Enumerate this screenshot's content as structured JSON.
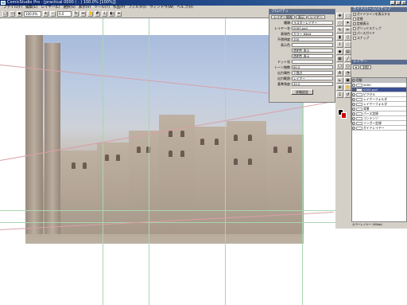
{
  "window": {
    "title": "ComicStudio Pro - [practical 0000 (  :  ) 100.0% [100%]]"
  },
  "menu": [
    "ファイル(F)",
    "編集(E)",
    "レイヤー(L)",
    "選択(S)",
    "表示(V)",
    "ツール(T)",
    "作品(P)",
    "フィルタ(I)",
    "ウィンドウ(W)",
    "ヘルプ(H)"
  ],
  "toolbar": {
    "zoom": "100.0%",
    "angle": "0.0"
  },
  "properties": {
    "title": "プロパティ",
    "tabs": [
      "レイヤー情報",
      "表示",
      "レイヤー"
    ],
    "rows": [
      {
        "label": "種類",
        "value": "ラスターレイヤー"
      },
      {
        "label": "レイヤー名",
        "value": "0000.psd"
      },
      {
        "label": "表現色",
        "value": "カラー 64bit"
      },
      {
        "label": "不透明度",
        "value": "100"
      },
      {
        "label": "表示色",
        "value": ""
      },
      {
        "label": "",
        "value": "透明色 表示"
      },
      {
        "label": "",
        "value": "透明色 表示"
      },
      {
        "label": "ドット化",
        "value": ""
      },
      {
        "label": "トーン線数",
        "value": "60.0"
      },
      {
        "label": "出力属性",
        "value": "下描き"
      },
      {
        "label": "出力範囲",
        "value": "レイヤー"
      },
      {
        "label": "基準角度",
        "value": "45.0"
      }
    ],
    "button": "詳細設定"
  },
  "guides_panel": {
    "title": "ガイド/パース/スナップ",
    "items": [
      "ガイドラインを表示する",
      "定規",
      "定規表示",
      "グリッドスナップ",
      "パースガイド",
      "スナップ"
    ]
  },
  "layers": {
    "title": "レイヤー",
    "items": [
      {
        "name": "用紙",
        "type": "folder"
      },
      {
        "name": "0000",
        "type": "group"
      },
      {
        "name": "0000.psd",
        "type": "raster",
        "selected": true
      },
      {
        "name": "ピクセル",
        "type": "raster"
      },
      {
        "name": "レイヤーフォルダ",
        "type": "folder"
      },
      {
        "name": "レイヤーフォルダ",
        "type": "folder"
      },
      {
        "name": "背景",
        "type": "raster"
      },
      {
        "name": "パース定規",
        "type": "ruler"
      },
      {
        "name": "コンテンツ",
        "type": "raster"
      },
      {
        "name": "リンガー定規",
        "type": "ruler"
      },
      {
        "name": "ガイドレイヤー",
        "type": "ruler"
      }
    ],
    "status": "カラーレイヤー 400dpi"
  }
}
